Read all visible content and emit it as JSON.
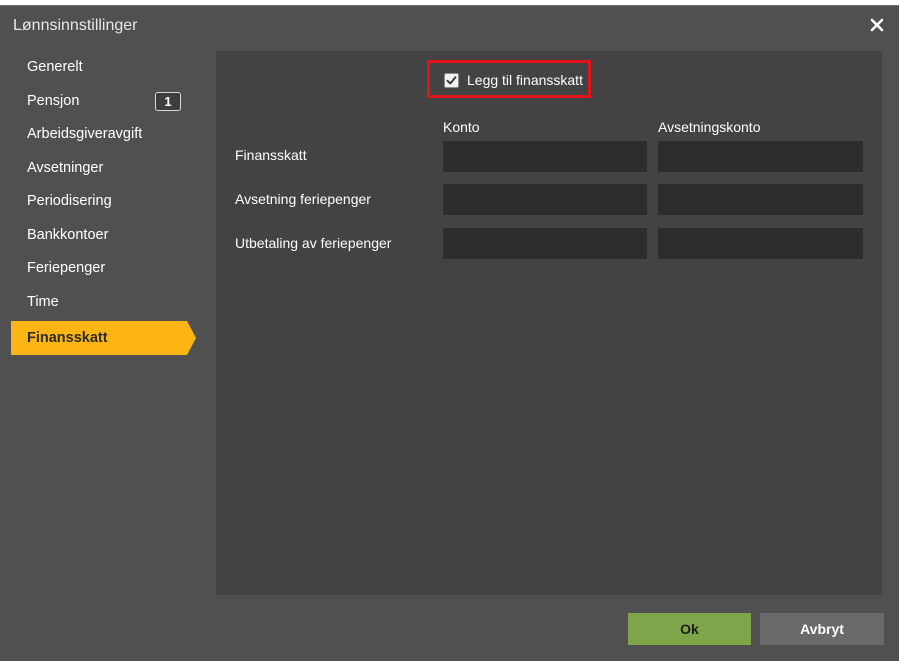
{
  "dialog": {
    "title": "Lønnsinnstillinger",
    "close_icon": "close-icon"
  },
  "sidebar": {
    "items": [
      {
        "label": "Generelt"
      },
      {
        "label": "Pensjon",
        "badge": "1"
      },
      {
        "label": "Arbeidsgiveravgift"
      },
      {
        "label": "Avsetninger"
      },
      {
        "label": "Periodisering"
      },
      {
        "label": "Bankkontoer"
      },
      {
        "label": "Feriepenger"
      },
      {
        "label": "Time"
      },
      {
        "label": "Finansskatt",
        "active": true
      }
    ]
  },
  "main": {
    "checkbox": {
      "label": "Legg til finansskatt",
      "checked": true,
      "highlight_color": "#e3131b"
    },
    "columns": {
      "konto": "Konto",
      "avsetningskonto": "Avsetningskonto"
    },
    "rows": [
      {
        "label": "Finansskatt",
        "konto": "",
        "avsetningskonto": ""
      },
      {
        "label": "Avsetning feriepenger",
        "konto": "",
        "avsetningskonto": ""
      },
      {
        "label": "Utbetaling av feriepenger",
        "konto": "",
        "avsetningskonto": ""
      }
    ]
  },
  "footer": {
    "ok_label": "Ok",
    "cancel_label": "Avbryt"
  },
  "colors": {
    "accent": "#fdb515",
    "ok_button": "#7ea54a",
    "background": "#505050",
    "panel": "#434343"
  }
}
